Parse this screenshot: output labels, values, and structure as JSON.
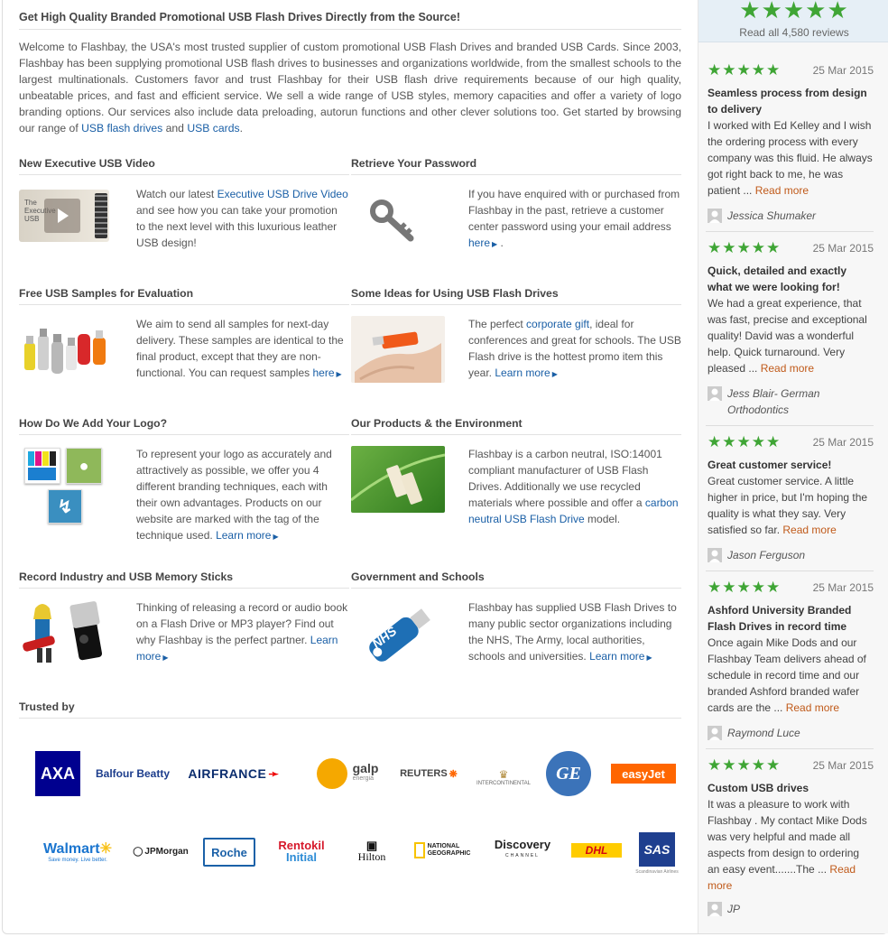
{
  "main": {
    "heading": "Get High Quality Branded Promotional USB Flash Drives Directly from the Source!",
    "intro": "Welcome to Flashbay, the USA's most trusted supplier of custom promotional USB Flash Drives and branded USB Cards. Since 2003, Flashbay has been supplying promotional USB flash drives to businesses and organizations worldwide, from the smallest schools to the largest multinationals. Customers favor and trust Flashbay for their USB flash drive requirements because of our high quality, unbeatable prices, and fast and efficient service. We sell a wide range of USB styles, memory capacities and offer a variety of logo branding options. Our services also include data preloading, autorun functions and other clever solutions too. Get started by browsing our range of ",
    "intro_link1": "USB flash drives",
    "intro_mid": " and ",
    "intro_link2": "USB cards",
    "intro_end": "."
  },
  "sections": {
    "video": {
      "title": "New Executive USB Video",
      "img_text": "The Executive USB",
      "t1": "Watch our latest ",
      "link": "Executive USB Drive Video",
      "t2": " and see how you can take your promotion to the next level with this luxurious leather USB design!"
    },
    "password": {
      "title": "Retrieve Your Password",
      "t1": "If you have enquired with or purchased from Flashbay in the past, retrieve a customer center password using your email address ",
      "link": "here",
      "t2": " ."
    },
    "samples": {
      "title": "Free USB Samples for Evaluation",
      "t1": "We aim to send all samples for next-day delivery. These samples are identical to the final product, except that they are non-functional. You can request samples ",
      "link": "here"
    },
    "ideas": {
      "title": "Some Ideas for Using USB Flash Drives",
      "t1": "The perfect ",
      "link1": "corporate gift",
      "t2": ", ideal for conferences and great for schools. The USB Flash drive is the hottest promo item this year. ",
      "link2": "Learn more"
    },
    "logo": {
      "title": "How Do We Add Your Logo?",
      "t1": "To represent your logo as accurately and attractively as possible, we offer you 4 different branding techniques, each with their own advantages. Products on our website are marked with the tag of the technique used. ",
      "link": "Learn more"
    },
    "environment": {
      "title": "Our Products & the Environment",
      "t1": "Flashbay is a carbon neutral, ISO:14001 compliant manufacturer of USB Flash Drives. Additionally we use recycled materials where possible and offer a ",
      "link": "carbon neutral USB Flash Drive",
      "t2": " model."
    },
    "record": {
      "title": "Record Industry and USB Memory Sticks",
      "t1": "Thinking of releasing a record or audio book on a Flash Drive or MP3 player? Find out why Flashbay is the perfect partner. ",
      "link": "Learn more"
    },
    "government": {
      "title": "Government and Schools",
      "img_text": "NHS",
      "t1": "Flashbay has supplied USB Flash Drives to many public sector organizations including the NHS, The Army, local authorities, schools and universities. ",
      "link": "Learn more"
    }
  },
  "trusted": {
    "title": "Trusted by",
    "logos": [
      "AXA",
      "Balfour Beatty",
      "AIRFRANCE",
      "galp",
      "energia",
      "REUTERS",
      "INTERCONTINENTAL",
      "GE",
      "easyJet",
      "Walmart",
      "Save money. Live better.",
      "JPMorgan",
      "Roche",
      "Rentokil",
      "Initial",
      "Hilton",
      "NATIONAL",
      "GEOGRAPHIC",
      "Discovery",
      "CHANNEL",
      "DHL",
      "SAS",
      "Scandinavian Airlines"
    ]
  },
  "sidebar": {
    "read_all": "Read all 4,580 reviews",
    "more_label": "Read more",
    "reviews": [
      {
        "date": "25 Mar 2015",
        "title": "Seamless process from design to delivery",
        "body": "I worked with Ed Kelley and I wish the ordering process with every company was this fluid. He always got right back to me, he was patient ... ",
        "author": "Jessica Shumaker"
      },
      {
        "date": "25 Mar 2015",
        "title": "Quick, detailed and exactly what we were looking for!",
        "body": "We had a great experience, that was fast, precise and exceptional quality! David was a wonderful help. Quick turnaround. Very pleased ... ",
        "author": "Jess Blair- German Orthodontics"
      },
      {
        "date": "25 Mar 2015",
        "title": "Great customer service!",
        "body": "Great customer service. A little higher in price, but I'm hoping the quality is what they say. Very satisfied so far. ",
        "author": "Jason Ferguson"
      },
      {
        "date": "25 Mar 2015",
        "title": "Ashford University Branded Flash Drives in record time",
        "body": "Once again Mike Dods and our Flashbay Team delivers ahead of schedule in record time and our branded Ashford branded wafer cards are the ... ",
        "author": "Raymond Luce"
      },
      {
        "date": "25 Mar 2015",
        "title": "Custom USB drives",
        "body": "It was a pleasure to work with Flashbay . My contact Mike Dods was very helpful and made all aspects from design to ordering an easy event.......The ... ",
        "author": "JP"
      }
    ]
  },
  "colors": {
    "link": "#1a5fa6",
    "stars": "#3fa535",
    "more": "#c05a1a"
  }
}
